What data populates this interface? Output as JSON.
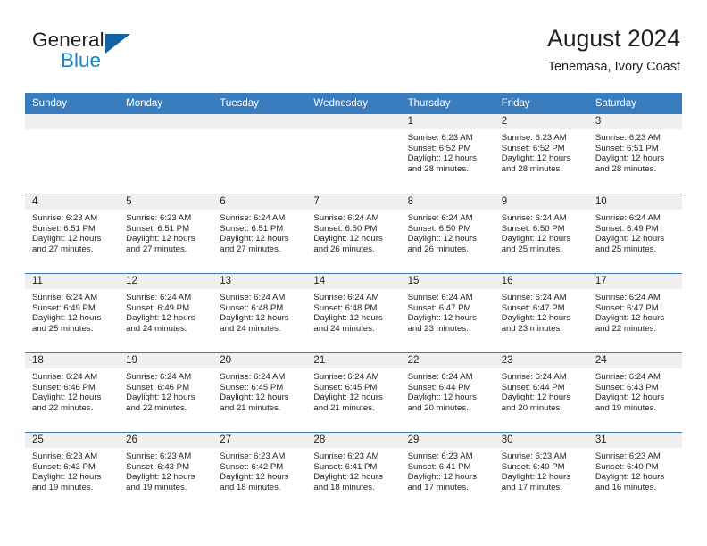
{
  "logo": {
    "word_top": "General",
    "word_bottom": "Blue",
    "triangle_color": "#1464a5",
    "blue_text_color": "#1a7fc1"
  },
  "header": {
    "title": "August 2024",
    "subtitle": "Tenemasa, Ivory Coast"
  },
  "theme": {
    "header_blue": "#3a7dbf",
    "daynum_band": "#f0f0f0",
    "text": "#231f20"
  },
  "weekdays": [
    "Sunday",
    "Monday",
    "Tuesday",
    "Wednesday",
    "Thursday",
    "Friday",
    "Saturday"
  ],
  "weeks": [
    [
      {
        "day": "",
        "sunrise": "",
        "sunset": "",
        "daylight1": "",
        "daylight2": ""
      },
      {
        "day": "",
        "sunrise": "",
        "sunset": "",
        "daylight1": "",
        "daylight2": ""
      },
      {
        "day": "",
        "sunrise": "",
        "sunset": "",
        "daylight1": "",
        "daylight2": ""
      },
      {
        "day": "",
        "sunrise": "",
        "sunset": "",
        "daylight1": "",
        "daylight2": ""
      },
      {
        "day": "1",
        "sunrise": "Sunrise: 6:23 AM",
        "sunset": "Sunset: 6:52 PM",
        "daylight1": "Daylight: 12 hours",
        "daylight2": "and 28 minutes."
      },
      {
        "day": "2",
        "sunrise": "Sunrise: 6:23 AM",
        "sunset": "Sunset: 6:52 PM",
        "daylight1": "Daylight: 12 hours",
        "daylight2": "and 28 minutes."
      },
      {
        "day": "3",
        "sunrise": "Sunrise: 6:23 AM",
        "sunset": "Sunset: 6:51 PM",
        "daylight1": "Daylight: 12 hours",
        "daylight2": "and 28 minutes."
      }
    ],
    [
      {
        "day": "4",
        "sunrise": "Sunrise: 6:23 AM",
        "sunset": "Sunset: 6:51 PM",
        "daylight1": "Daylight: 12 hours",
        "daylight2": "and 27 minutes."
      },
      {
        "day": "5",
        "sunrise": "Sunrise: 6:23 AM",
        "sunset": "Sunset: 6:51 PM",
        "daylight1": "Daylight: 12 hours",
        "daylight2": "and 27 minutes."
      },
      {
        "day": "6",
        "sunrise": "Sunrise: 6:24 AM",
        "sunset": "Sunset: 6:51 PM",
        "daylight1": "Daylight: 12 hours",
        "daylight2": "and 27 minutes."
      },
      {
        "day": "7",
        "sunrise": "Sunrise: 6:24 AM",
        "sunset": "Sunset: 6:50 PM",
        "daylight1": "Daylight: 12 hours",
        "daylight2": "and 26 minutes."
      },
      {
        "day": "8",
        "sunrise": "Sunrise: 6:24 AM",
        "sunset": "Sunset: 6:50 PM",
        "daylight1": "Daylight: 12 hours",
        "daylight2": "and 26 minutes."
      },
      {
        "day": "9",
        "sunrise": "Sunrise: 6:24 AM",
        "sunset": "Sunset: 6:50 PM",
        "daylight1": "Daylight: 12 hours",
        "daylight2": "and 25 minutes."
      },
      {
        "day": "10",
        "sunrise": "Sunrise: 6:24 AM",
        "sunset": "Sunset: 6:49 PM",
        "daylight1": "Daylight: 12 hours",
        "daylight2": "and 25 minutes."
      }
    ],
    [
      {
        "day": "11",
        "sunrise": "Sunrise: 6:24 AM",
        "sunset": "Sunset: 6:49 PM",
        "daylight1": "Daylight: 12 hours",
        "daylight2": "and 25 minutes."
      },
      {
        "day": "12",
        "sunrise": "Sunrise: 6:24 AM",
        "sunset": "Sunset: 6:49 PM",
        "daylight1": "Daylight: 12 hours",
        "daylight2": "and 24 minutes."
      },
      {
        "day": "13",
        "sunrise": "Sunrise: 6:24 AM",
        "sunset": "Sunset: 6:48 PM",
        "daylight1": "Daylight: 12 hours",
        "daylight2": "and 24 minutes."
      },
      {
        "day": "14",
        "sunrise": "Sunrise: 6:24 AM",
        "sunset": "Sunset: 6:48 PM",
        "daylight1": "Daylight: 12 hours",
        "daylight2": "and 24 minutes."
      },
      {
        "day": "15",
        "sunrise": "Sunrise: 6:24 AM",
        "sunset": "Sunset: 6:47 PM",
        "daylight1": "Daylight: 12 hours",
        "daylight2": "and 23 minutes."
      },
      {
        "day": "16",
        "sunrise": "Sunrise: 6:24 AM",
        "sunset": "Sunset: 6:47 PM",
        "daylight1": "Daylight: 12 hours",
        "daylight2": "and 23 minutes."
      },
      {
        "day": "17",
        "sunrise": "Sunrise: 6:24 AM",
        "sunset": "Sunset: 6:47 PM",
        "daylight1": "Daylight: 12 hours",
        "daylight2": "and 22 minutes."
      }
    ],
    [
      {
        "day": "18",
        "sunrise": "Sunrise: 6:24 AM",
        "sunset": "Sunset: 6:46 PM",
        "daylight1": "Daylight: 12 hours",
        "daylight2": "and 22 minutes."
      },
      {
        "day": "19",
        "sunrise": "Sunrise: 6:24 AM",
        "sunset": "Sunset: 6:46 PM",
        "daylight1": "Daylight: 12 hours",
        "daylight2": "and 22 minutes."
      },
      {
        "day": "20",
        "sunrise": "Sunrise: 6:24 AM",
        "sunset": "Sunset: 6:45 PM",
        "daylight1": "Daylight: 12 hours",
        "daylight2": "and 21 minutes."
      },
      {
        "day": "21",
        "sunrise": "Sunrise: 6:24 AM",
        "sunset": "Sunset: 6:45 PM",
        "daylight1": "Daylight: 12 hours",
        "daylight2": "and 21 minutes."
      },
      {
        "day": "22",
        "sunrise": "Sunrise: 6:24 AM",
        "sunset": "Sunset: 6:44 PM",
        "daylight1": "Daylight: 12 hours",
        "daylight2": "and 20 minutes."
      },
      {
        "day": "23",
        "sunrise": "Sunrise: 6:24 AM",
        "sunset": "Sunset: 6:44 PM",
        "daylight1": "Daylight: 12 hours",
        "daylight2": "and 20 minutes."
      },
      {
        "day": "24",
        "sunrise": "Sunrise: 6:24 AM",
        "sunset": "Sunset: 6:43 PM",
        "daylight1": "Daylight: 12 hours",
        "daylight2": "and 19 minutes."
      }
    ],
    [
      {
        "day": "25",
        "sunrise": "Sunrise: 6:23 AM",
        "sunset": "Sunset: 6:43 PM",
        "daylight1": "Daylight: 12 hours",
        "daylight2": "and 19 minutes."
      },
      {
        "day": "26",
        "sunrise": "Sunrise: 6:23 AM",
        "sunset": "Sunset: 6:43 PM",
        "daylight1": "Daylight: 12 hours",
        "daylight2": "and 19 minutes."
      },
      {
        "day": "27",
        "sunrise": "Sunrise: 6:23 AM",
        "sunset": "Sunset: 6:42 PM",
        "daylight1": "Daylight: 12 hours",
        "daylight2": "and 18 minutes."
      },
      {
        "day": "28",
        "sunrise": "Sunrise: 6:23 AM",
        "sunset": "Sunset: 6:41 PM",
        "daylight1": "Daylight: 12 hours",
        "daylight2": "and 18 minutes."
      },
      {
        "day": "29",
        "sunrise": "Sunrise: 6:23 AM",
        "sunset": "Sunset: 6:41 PM",
        "daylight1": "Daylight: 12 hours",
        "daylight2": "and 17 minutes."
      },
      {
        "day": "30",
        "sunrise": "Sunrise: 6:23 AM",
        "sunset": "Sunset: 6:40 PM",
        "daylight1": "Daylight: 12 hours",
        "daylight2": "and 17 minutes."
      },
      {
        "day": "31",
        "sunrise": "Sunrise: 6:23 AM",
        "sunset": "Sunset: 6:40 PM",
        "daylight1": "Daylight: 12 hours",
        "daylight2": "and 16 minutes."
      }
    ]
  ]
}
